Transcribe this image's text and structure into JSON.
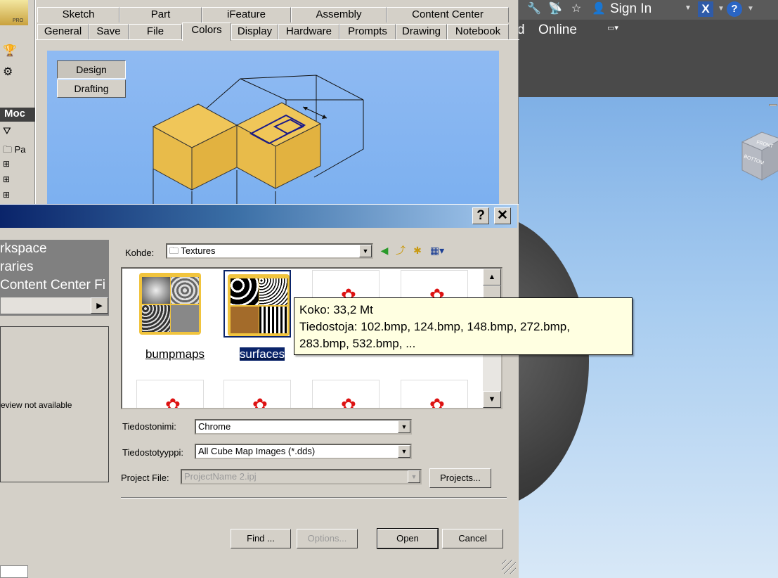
{
  "app": {
    "sign_in": "Sign In",
    "online": "Online",
    "partial_label": "d",
    "pro_logo_text": "PRO",
    "model_header": "Moc",
    "tree_item": "Pa"
  },
  "options": {
    "tabs_row1": [
      "Sketch",
      "Part",
      "iFeature",
      "Assembly",
      "Content Center"
    ],
    "tabs_row2": [
      "General",
      "Save",
      "File",
      "Colors",
      "Display",
      "Hardware",
      "Prompts",
      "Drawing",
      "Notebook"
    ],
    "active_tab": "Colors",
    "scheme_buttons": [
      "Design",
      "Drafting"
    ]
  },
  "dialog": {
    "locations": [
      "rkspace",
      "raries",
      "Content Center Fi"
    ],
    "preview_text": "eview not available",
    "lookin_label": "Kohde:",
    "lookin_value": "Textures",
    "files": [
      {
        "name": "bumpmaps",
        "type": "folder"
      },
      {
        "name": "surfaces",
        "type": "folder",
        "selected": true
      },
      {
        "name": "",
        "type": "file"
      },
      {
        "name": "",
        "type": "file"
      },
      {
        "name": "",
        "type": "file"
      },
      {
        "name": "",
        "type": "file"
      },
      {
        "name": "",
        "type": "file"
      },
      {
        "name": "",
        "type": "file"
      }
    ],
    "tooltip": {
      "line1": "Koko: 33,2 Mt",
      "line2": "Tiedostoja: 102.bmp, 124.bmp, 148.bmp, 272.bmp,",
      "line3": "283.bmp, 532.bmp, ..."
    },
    "filename_label": "Tiedostonimi:",
    "filename_value": "Chrome",
    "filetype_label": "Tiedostotyyppi:",
    "filetype_value": "All Cube Map Images (*.dds)",
    "project_label": "Project File:",
    "project_value": "ProjectName 2.ipj",
    "projects_button": "Projects...",
    "find_button": "Find ...",
    "options_button": "Options...",
    "open_button": "Open",
    "cancel_button": "Cancel",
    "help_button": "?",
    "close_button": "✕"
  }
}
